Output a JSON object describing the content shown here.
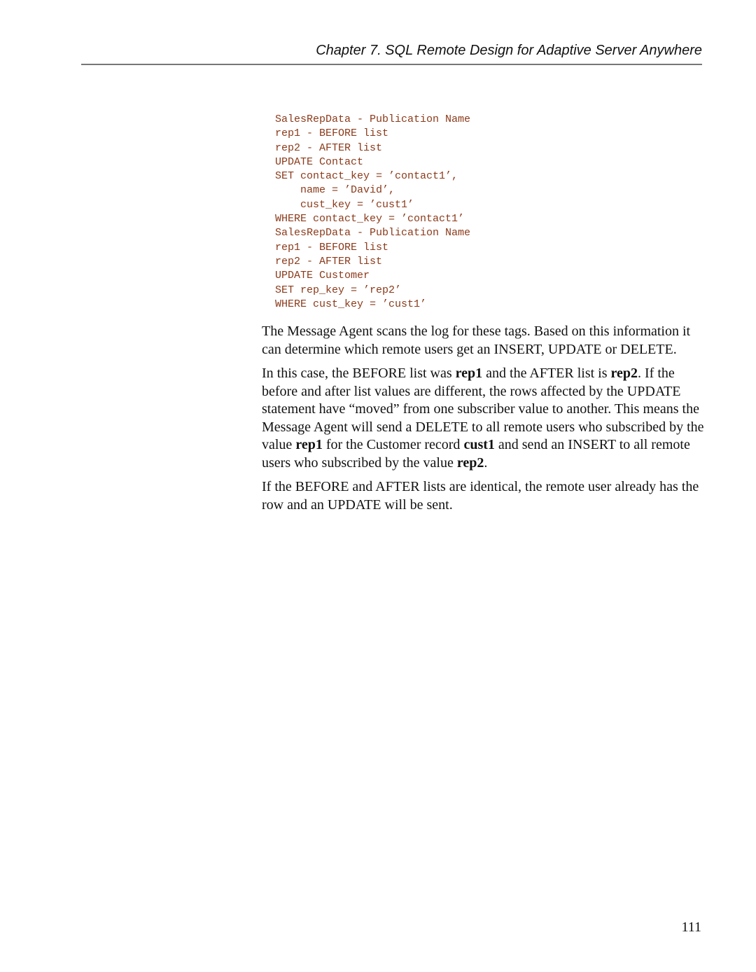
{
  "header": {
    "title": "Chapter 7.  SQL Remote Design for Adaptive Server Anywhere"
  },
  "code_block": {
    "lines": [
      "SalesRepData - Publication Name",
      "rep1 - BEFORE list",
      "rep2 - AFTER list",
      "UPDATE Contact",
      "SET contact_key = ’contact1’,",
      "    name = ’David’,",
      "    cust_key = ’cust1’",
      "WHERE contact_key = ’contact1’",
      "SalesRepData - Publication Name",
      "rep1 - BEFORE list",
      "rep2 - AFTER list",
      "UPDATE Customer",
      "SET rep_key = ’rep2’",
      "WHERE cust_key = ’cust1’"
    ]
  },
  "paragraphs": {
    "p1": "The Message Agent scans the log for these tags. Based on this information it can determine which remote users get an INSERT, UPDATE or DELETE.",
    "p2": {
      "t1": "In this case, the BEFORE list was ",
      "b1": "rep1",
      "t2": " and the AFTER list is ",
      "b2": "rep2",
      "t3": ". If the before and after list values are different, the rows affected by the UPDATE statement have “moved” from one subscriber value to another. This means the Message Agent will send a DELETE to all remote users who subscribed by the value ",
      "b3": "rep1",
      "t4": " for the Customer record ",
      "b4": "cust1",
      "t5": " and send an INSERT to all remote users who subscribed by the value ",
      "b5": "rep2",
      "t6": "."
    },
    "p3": "If the BEFORE and AFTER lists are identical, the remote user already has the row and an UPDATE will be sent."
  },
  "footer": {
    "page_number": "111"
  },
  "colors": {
    "code_text": "#8b3a1a",
    "body_text": "#111111",
    "header_rule": "#777777"
  }
}
